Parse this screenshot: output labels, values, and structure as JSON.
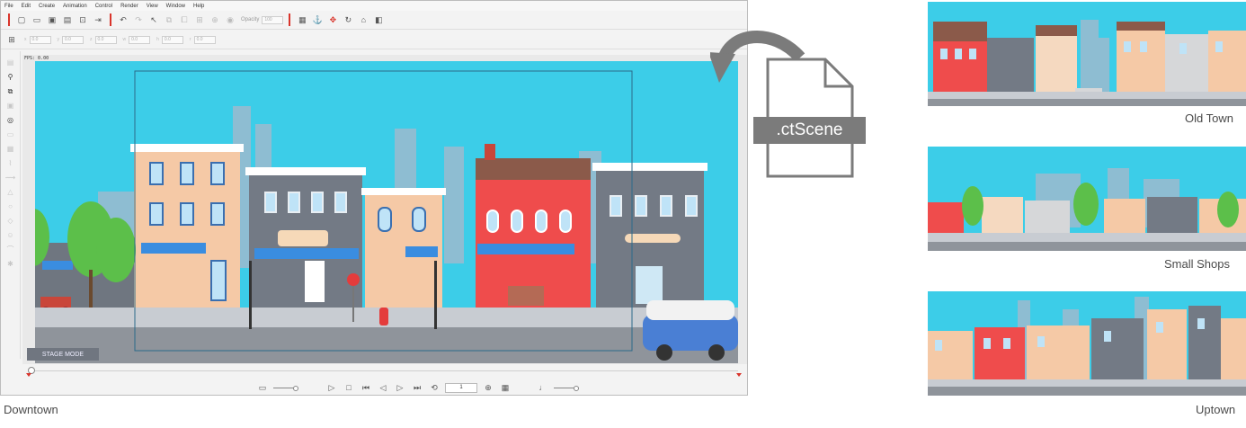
{
  "menu": [
    "File",
    "Edit",
    "Create",
    "Animation",
    "Control",
    "Render",
    "View",
    "Window",
    "Help"
  ],
  "toolbar": {
    "opacity_label": "Opacity",
    "opacity_value": "100"
  },
  "transform_fields": [
    "0.0",
    "0.0",
    "0.0",
    "0.0",
    "0.0",
    "0.0"
  ],
  "stage": {
    "fps_label": "FPS: 0.00",
    "stage_mode_label": "STAGE MODE"
  },
  "playback": {
    "frame_value": "1"
  },
  "file_label": ".ctScene",
  "captions": {
    "main": "Downtown",
    "old_town": "Old Town",
    "small_shops": "Small Shops",
    "uptown": "Uptown"
  },
  "colors": {
    "accent_red": "#d9342b",
    "sky": "#3ccde8",
    "file_gray": "#7b7b7b"
  }
}
